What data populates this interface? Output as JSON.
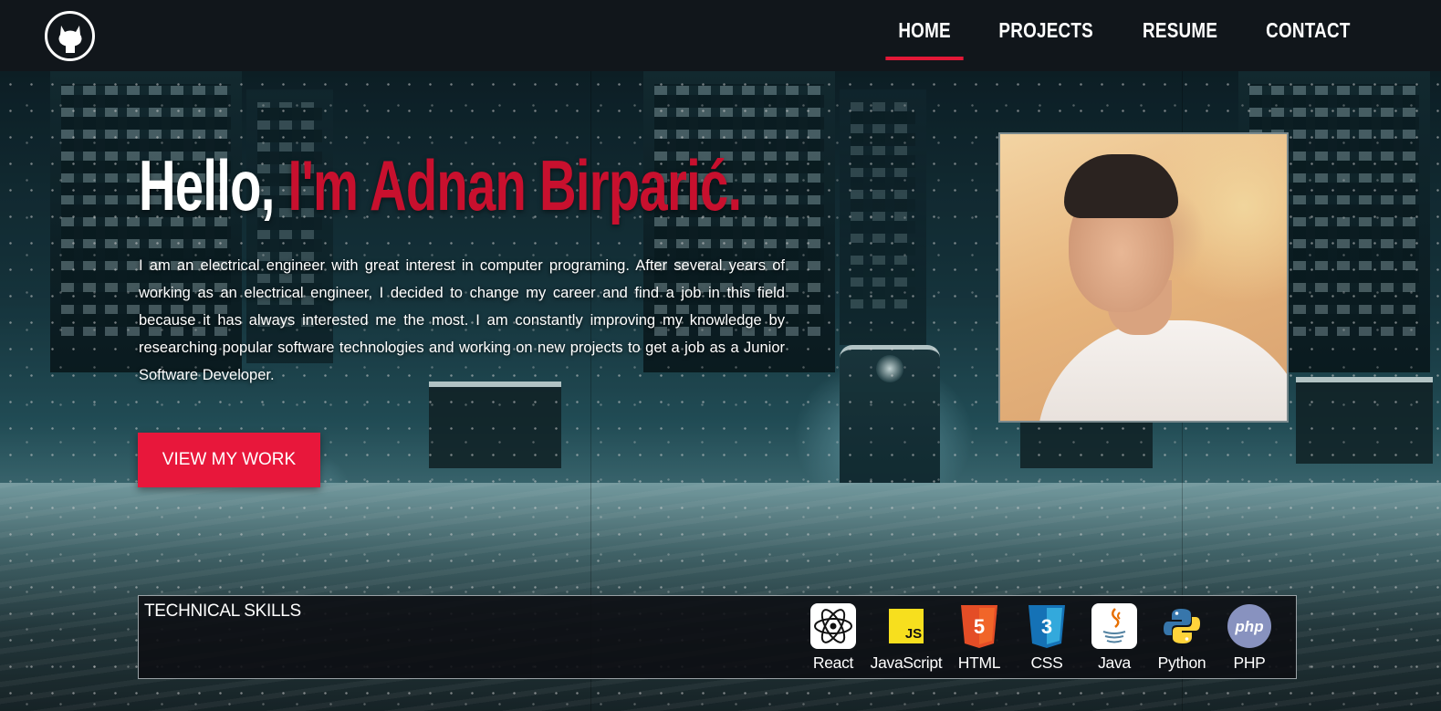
{
  "nav": {
    "logo_icon": "github-icon",
    "items": [
      {
        "label": "HOME",
        "active": true
      },
      {
        "label": "PROJECTS",
        "active": false
      },
      {
        "label": "RESUME",
        "active": false
      },
      {
        "label": "CONTACT",
        "active": false
      }
    ],
    "accent": "#e31837"
  },
  "hero": {
    "greeting": "Hello,",
    "name": "I'm Adnan Birparić.",
    "bio": "I am an electrical engineer with great interest in computer programing. After several years of working as an electrical engineer, I decided to change my career and find a job in this field because it has always interested me the most. I am constantly improving my knowledge by researching popular software technologies and working on new projects to get a job as a Junior Software Developer.",
    "cta_label": "VIEW MY WORK",
    "name_color": "#c8102e",
    "cta_color": "#e8173b"
  },
  "skills": {
    "title": "TECHNICAL SKILLS",
    "items": [
      {
        "label": "React",
        "icon": "react-icon"
      },
      {
        "label": "JavaScript",
        "icon": "javascript-icon"
      },
      {
        "label": "HTML",
        "icon": "html5-icon"
      },
      {
        "label": "CSS",
        "icon": "css3-icon"
      },
      {
        "label": "Java",
        "icon": "java-icon"
      },
      {
        "label": "Python",
        "icon": "python-icon"
      },
      {
        "label": "PHP",
        "icon": "php-icon"
      }
    ]
  }
}
